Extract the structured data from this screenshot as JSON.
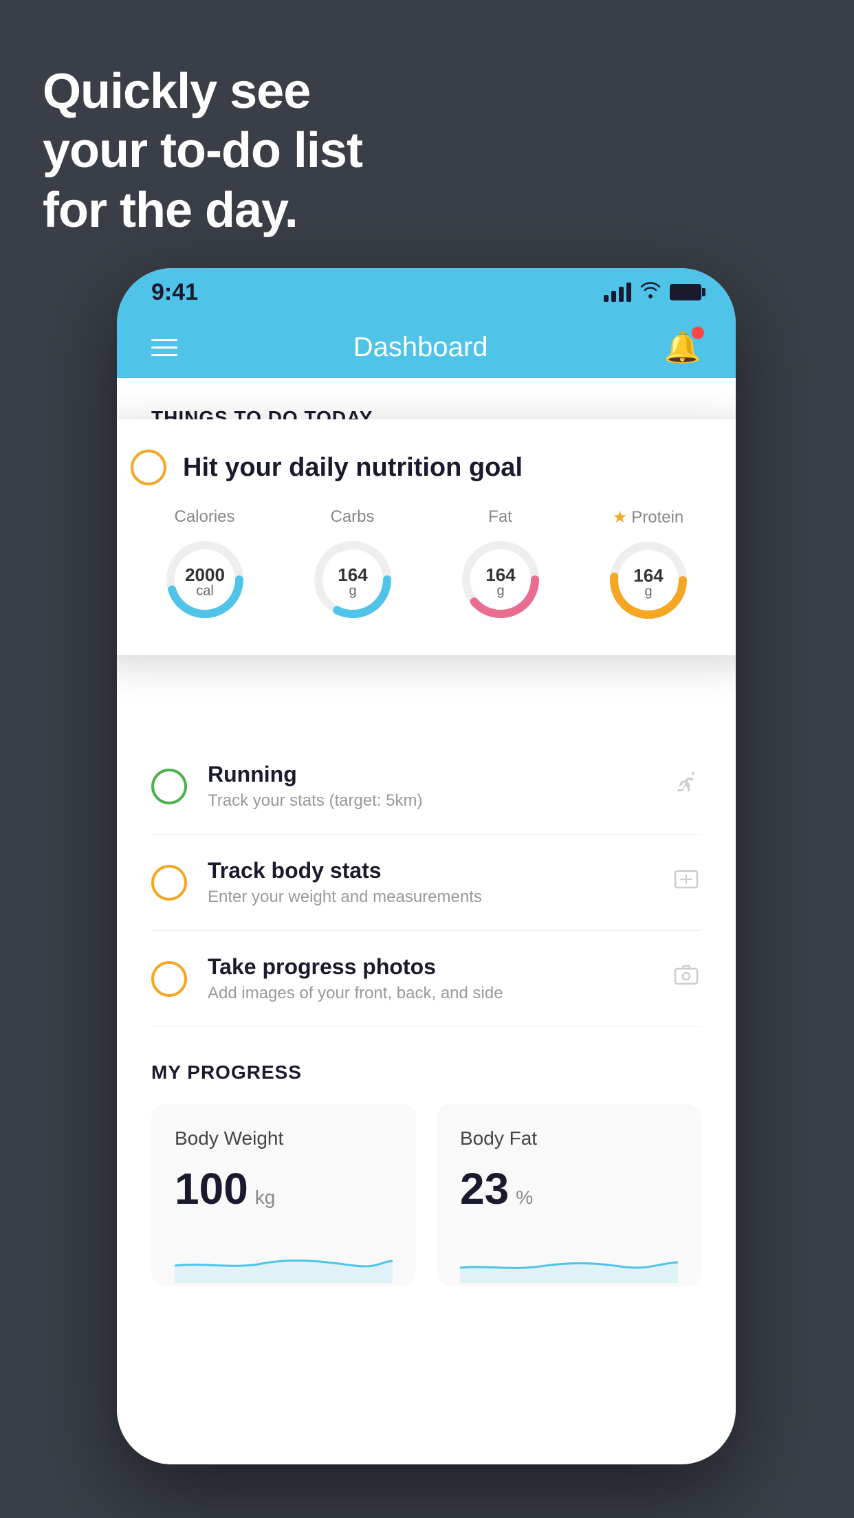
{
  "hero": {
    "line1": "Quickly see",
    "line2": "your to-do list",
    "line3": "for the day."
  },
  "status_bar": {
    "time": "9:41"
  },
  "header": {
    "title": "Dashboard"
  },
  "things_section": {
    "label": "THINGS TO DO TODAY"
  },
  "floating_card": {
    "title": "Hit your daily nutrition goal",
    "nutrition": [
      {
        "label": "Calories",
        "value": "2000",
        "unit": "cal",
        "color": "#4fc3e8",
        "star": false
      },
      {
        "label": "Carbs",
        "value": "164",
        "unit": "g",
        "color": "#4fc3e8",
        "star": false
      },
      {
        "label": "Fat",
        "value": "164",
        "unit": "g",
        "color": "#e96d8e",
        "star": false
      },
      {
        "label": "Protein",
        "value": "164",
        "unit": "g",
        "color": "#f5a623",
        "star": true
      }
    ]
  },
  "todo_items": [
    {
      "title": "Running",
      "subtitle": "Track your stats (target: 5km)",
      "circle_color": "green",
      "icon": "👟"
    },
    {
      "title": "Track body stats",
      "subtitle": "Enter your weight and measurements",
      "circle_color": "yellow",
      "icon": "⚖️"
    },
    {
      "title": "Take progress photos",
      "subtitle": "Add images of your front, back, and side",
      "circle_color": "yellow",
      "icon": "🖼️"
    }
  ],
  "progress_section": {
    "label": "MY PROGRESS",
    "cards": [
      {
        "title": "Body Weight",
        "value": "100",
        "unit": "kg"
      },
      {
        "title": "Body Fat",
        "value": "23",
        "unit": "%"
      }
    ]
  }
}
